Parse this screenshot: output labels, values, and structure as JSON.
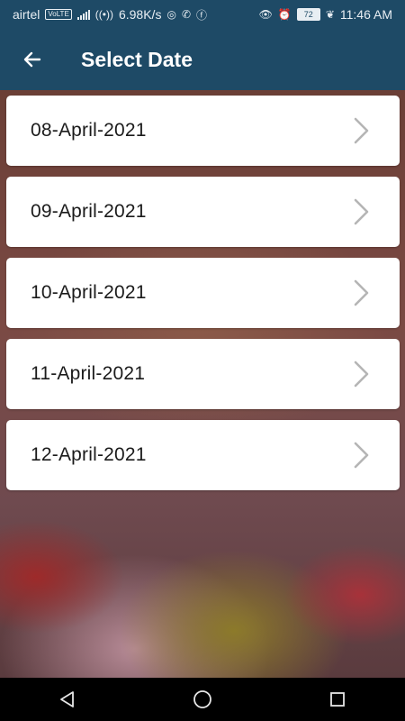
{
  "status_bar": {
    "carrier": "airtel",
    "volte": "VoLTE",
    "network": "4G",
    "speed": "6.98K/s",
    "battery": "72",
    "time": "11:46 AM"
  },
  "app_bar": {
    "title": "Select Date",
    "back_icon": "arrow-left-icon"
  },
  "dates": [
    {
      "label": "08-April-2021"
    },
    {
      "label": "09-April-2021"
    },
    {
      "label": "10-April-2021"
    },
    {
      "label": "11-April-2021"
    },
    {
      "label": "12-April-2021"
    }
  ],
  "nav": {
    "back_icon": "triangle-back-icon",
    "home_icon": "circle-home-icon",
    "recents_icon": "square-recents-icon"
  },
  "colors": {
    "app_bar": "#1e4a66",
    "card": "#ffffff",
    "chevron": "#b5b5b5"
  }
}
